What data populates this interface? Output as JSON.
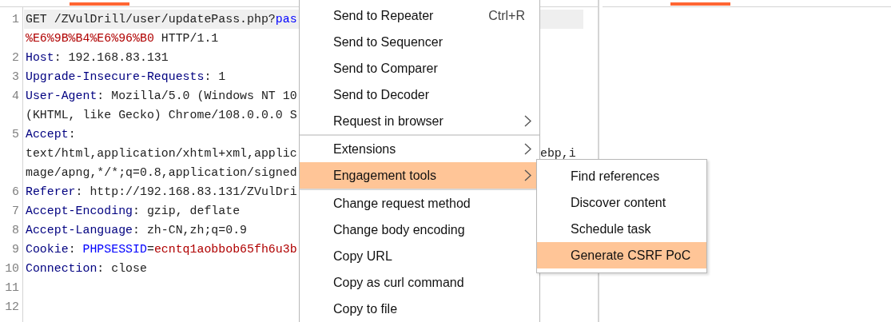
{
  "editor": {
    "rows": [
      {
        "number": "1",
        "highlighted": true,
        "segments": [
          {
            "kind": "plain",
            "text": "GET /ZVulDrill/user/updatePass.php?"
          },
          {
            "kind": "param",
            "text": "pas"
          }
        ]
      },
      {
        "highlighted": false,
        "segments": [
          {
            "kind": "encoded",
            "text": "%E6%9B%B4%E6%96%B0"
          },
          {
            "kind": "plain",
            "text": " HTTP/1.1"
          }
        ]
      },
      {
        "number": "2",
        "highlighted": false,
        "segments": [
          {
            "kind": "name",
            "text": "Host"
          },
          {
            "kind": "plain",
            "text": ": 192.168.83.131"
          }
        ]
      },
      {
        "number": "3",
        "highlighted": false,
        "segments": [
          {
            "kind": "name",
            "text": "Upgrade-Insecure-Requests"
          },
          {
            "kind": "plain",
            "text": ": 1"
          }
        ]
      },
      {
        "number": "4",
        "highlighted": false,
        "segments": [
          {
            "kind": "name",
            "text": "User-Agent"
          },
          {
            "kind": "plain",
            "text": ": Mozilla/5.0 (Windows NT 10"
          }
        ]
      },
      {
        "highlighted": false,
        "segments": [
          {
            "kind": "plain",
            "text": "(KHTML, like Gecko) Chrome/108.0.0.0 S"
          }
        ]
      },
      {
        "number": "5",
        "highlighted": false,
        "segments": [
          {
            "kind": "name",
            "text": "Accept"
          },
          {
            "kind": "plain",
            "text": ":"
          }
        ]
      },
      {
        "highlighted": false,
        "segments": [
          {
            "kind": "plain",
            "text": "text/html,application/xhtml+xml,applic"
          }
        ],
        "right": "ebp,i"
      },
      {
        "highlighted": false,
        "segments": [
          {
            "kind": "plain",
            "text": "mage/apng,*/*;q=0.8,application/signed"
          }
        ]
      },
      {
        "number": "6",
        "highlighted": false,
        "segments": [
          {
            "kind": "name",
            "text": "Referer"
          },
          {
            "kind": "plain",
            "text": ": http://192.168.83.131/ZVulDri"
          }
        ]
      },
      {
        "number": "7",
        "highlighted": false,
        "segments": [
          {
            "kind": "name",
            "text": "Accept-Encoding"
          },
          {
            "kind": "plain",
            "text": ": gzip, deflate"
          }
        ]
      },
      {
        "number": "8",
        "highlighted": false,
        "segments": [
          {
            "kind": "name",
            "text": "Accept-Language"
          },
          {
            "kind": "plain",
            "text": ": zh-CN,zh;q=0.9"
          }
        ]
      },
      {
        "number": "9",
        "highlighted": false,
        "segments": [
          {
            "kind": "name",
            "text": "Cookie"
          },
          {
            "kind": "plain",
            "text": ": "
          },
          {
            "kind": "param",
            "text": "PHPSESSID"
          },
          {
            "kind": "plain",
            "text": "="
          },
          {
            "kind": "encoded",
            "text": "ecntq1aobbob65fh6u3b"
          }
        ]
      },
      {
        "number": "10",
        "highlighted": false,
        "segments": [
          {
            "kind": "name",
            "text": "Connection"
          },
          {
            "kind": "plain",
            "text": ": close"
          }
        ]
      },
      {
        "number": "11",
        "highlighted": false,
        "segments": []
      },
      {
        "number": "12",
        "highlighted": false,
        "segments": []
      }
    ]
  },
  "context_menu": {
    "groups": [
      [
        {
          "label": "Send to Repeater",
          "shortcut": "Ctrl+R",
          "submenu": false,
          "selected": false
        },
        {
          "label": "Send to Sequencer",
          "submenu": false,
          "selected": false
        },
        {
          "label": "Send to Comparer",
          "submenu": false,
          "selected": false
        },
        {
          "label": "Send to Decoder",
          "submenu": false,
          "selected": false
        },
        {
          "label": "Request in browser",
          "submenu": true,
          "selected": false
        }
      ],
      [
        {
          "label": "Extensions",
          "submenu": true,
          "selected": false
        },
        {
          "label": "Engagement tools",
          "submenu": true,
          "selected": true
        }
      ],
      [
        {
          "label": "Change request method",
          "submenu": false,
          "selected": false
        },
        {
          "label": "Change body encoding",
          "submenu": false,
          "selected": false
        },
        {
          "label": "Copy URL",
          "submenu": false,
          "selected": false
        },
        {
          "label": "Copy as curl command",
          "submenu": false,
          "selected": false
        },
        {
          "label": "Copy to file",
          "submenu": false,
          "selected": false
        }
      ]
    ]
  },
  "submenu": {
    "items": [
      {
        "label": "Find references",
        "selected": false
      },
      {
        "label": "Discover content",
        "selected": false
      },
      {
        "label": "Schedule task",
        "selected": false
      },
      {
        "label": "Generate CSRF PoC",
        "selected": true
      }
    ]
  }
}
